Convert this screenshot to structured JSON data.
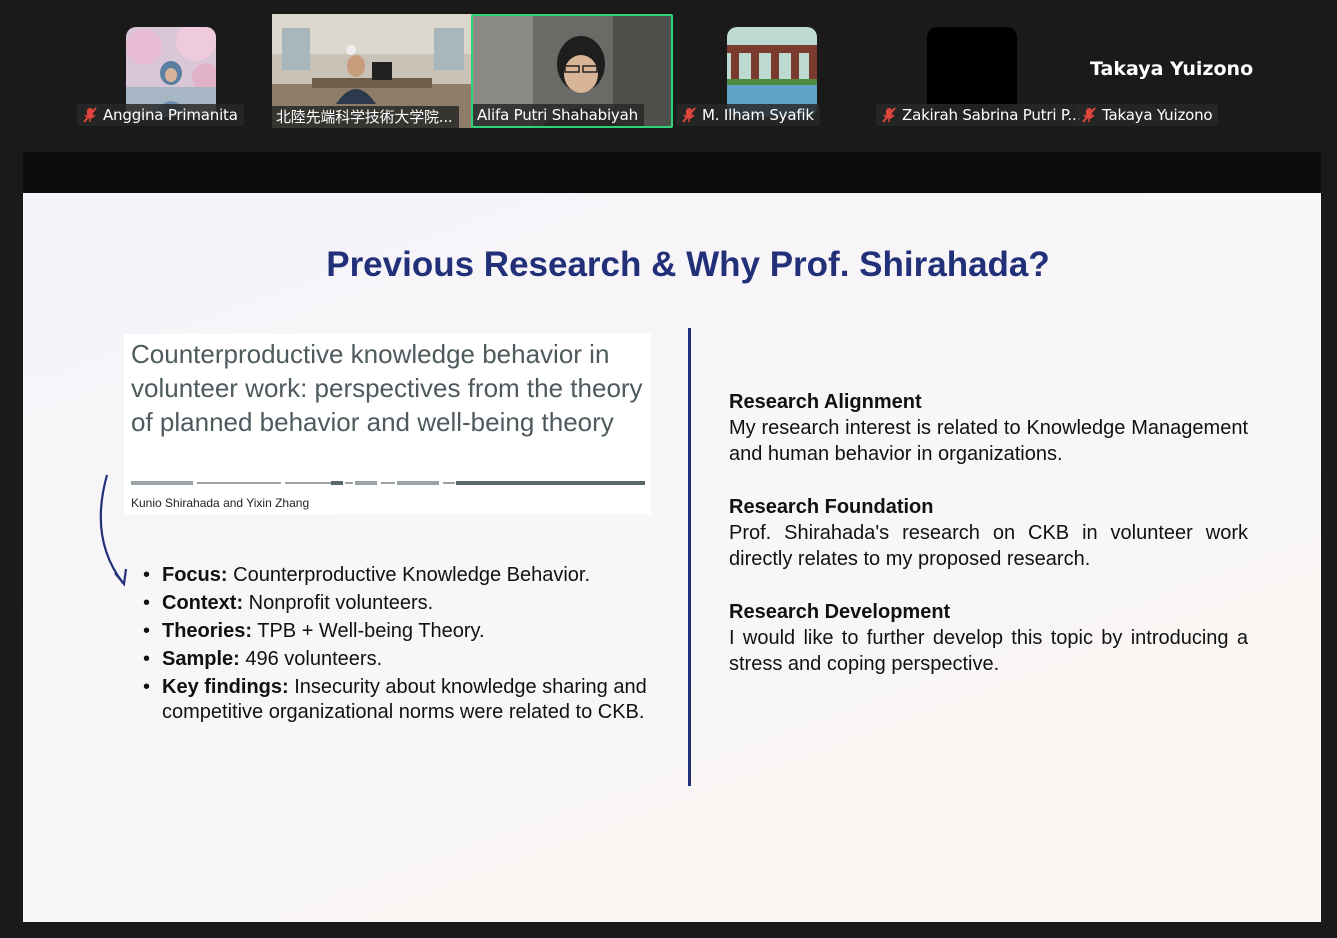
{
  "participants": [
    {
      "name": "Anggina Primanita",
      "muted": true
    },
    {
      "name": "北陸先端科学技術大学院...",
      "muted": false
    },
    {
      "name": "Alifa Putri Shahabiyah",
      "muted": false,
      "active": true
    },
    {
      "name": "M. Ilham Syafik",
      "muted": true
    },
    {
      "name": "Zakirah Sabrina Putri P...",
      "muted": true
    },
    {
      "name": "Takaya Yuizono",
      "muted": true
    }
  ],
  "speaker_display_name": "Takaya Yuizono",
  "slide": {
    "title": "Previous Research & Why Prof. Shirahada?",
    "paper": {
      "title": "Counterproductive knowledge behavior in volunteer work: perspectives from the theory of planned behavior and well-being theory",
      "authors": "Kunio Shirahada and Yixin Zhang"
    },
    "bullets": [
      {
        "label": "Focus:",
        "text": "Counterproductive Knowledge Behavior."
      },
      {
        "label": "Context:",
        "text": "Nonprofit volunteers."
      },
      {
        "label": "Theories:",
        "text": "TPB + Well-being Theory."
      },
      {
        "label": "Sample:",
        "text": "496 volunteers."
      },
      {
        "label": "Key findings:",
        "text": "Insecurity about knowledge sharing and competitive organizational norms were related to CKB."
      }
    ],
    "sections": [
      {
        "heading": "Research Alignment",
        "text": "My research interest is related to Knowledge Management and human behavior in organizations."
      },
      {
        "heading": "Research Foundation",
        "text": "Prof. Shirahada's research on CKB in volunteer work directly relates to my proposed research."
      },
      {
        "heading": "Research Development",
        "text": "I would like to further develop this topic by introducing a stress and coping perspective."
      }
    ]
  },
  "colors": {
    "accent": "#22307a",
    "active_speaker_border": "#2fd27a",
    "muted_icon": "#e0463c"
  }
}
